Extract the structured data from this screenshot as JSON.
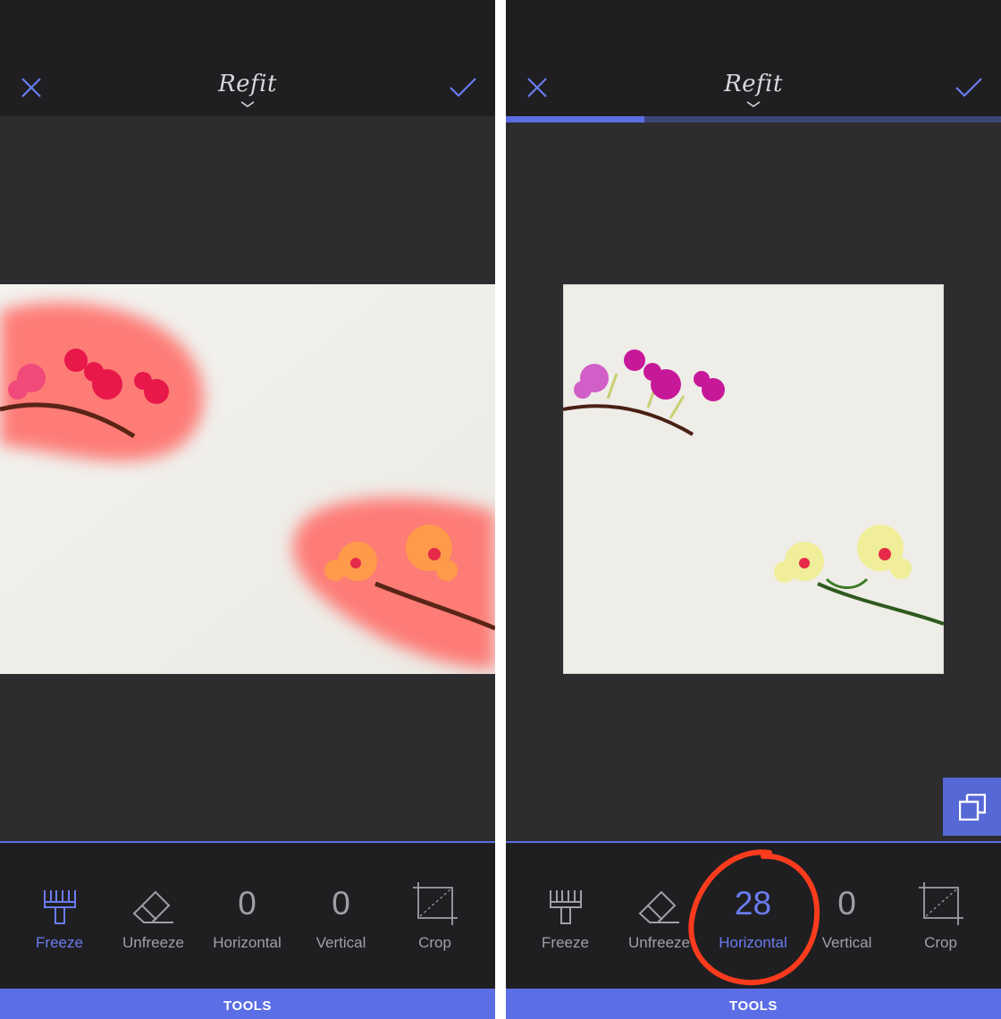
{
  "colors": {
    "accent": "#5b6ee6",
    "topbar": "#1f1f21",
    "canvas": "#2d2d30",
    "annotation": "#ff3b1e"
  },
  "panels": [
    {
      "title": "Refit",
      "progress": 0,
      "tools": [
        {
          "icon": "brush-icon",
          "label": "Freeze",
          "active": true
        },
        {
          "icon": "eraser-icon",
          "label": "Unfreeze",
          "active": false
        },
        {
          "value": "0",
          "label": "Horizontal",
          "active": false
        },
        {
          "value": "0",
          "label": "Vertical",
          "active": false
        },
        {
          "icon": "crop-icon",
          "label": "Crop",
          "active": false
        }
      ],
      "tools_bar_label": "TOOLS"
    },
    {
      "title": "Refit",
      "progress": 0.28,
      "tools": [
        {
          "icon": "brush-icon",
          "label": "Freeze",
          "active": false
        },
        {
          "icon": "eraser-icon",
          "label": "Unfreeze",
          "active": false
        },
        {
          "value": "28",
          "label": "Horizontal",
          "active": true
        },
        {
          "value": "0",
          "label": "Vertical",
          "active": false
        },
        {
          "icon": "crop-icon",
          "label": "Crop",
          "active": false
        }
      ],
      "tools_bar_label": "TOOLS"
    }
  ]
}
